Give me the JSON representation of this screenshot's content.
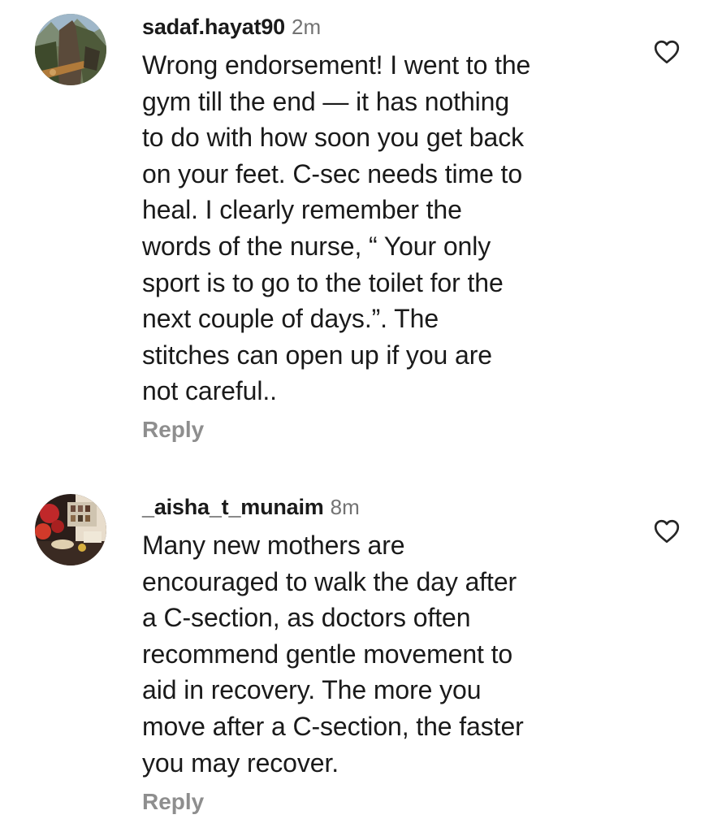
{
  "comments": [
    {
      "username": "sadaf.hayat90",
      "time": "2m",
      "text": "Wrong endorsement! I went to the\ngym till the end — it has nothing\nto do with how soon you get back\non your feet. C-sec needs time to\nheal. I clearly remember the\nwords of the nurse, “ Your only\nsport is to go to the toilet for the\nnext couple of days.”. The\nstitches can open up if you are\nnot careful..",
      "reply_label": "Reply",
      "like_icon": "heart-outline-icon"
    },
    {
      "username": "_aisha_t_munaim",
      "time": "8m",
      "text": "Many new mothers are\nencouraged to walk the day after\na C-section, as doctors often\nrecommend gentle movement to\naid in recovery. The more you\nmove after a C-section, the faster\nyou may recover.",
      "reply_label": "Reply",
      "like_icon": "heart-outline-icon"
    }
  ],
  "colors": {
    "text": "#1a1a1a",
    "muted": "#737373",
    "reply": "#8e8e8e",
    "icon": "#262626"
  }
}
